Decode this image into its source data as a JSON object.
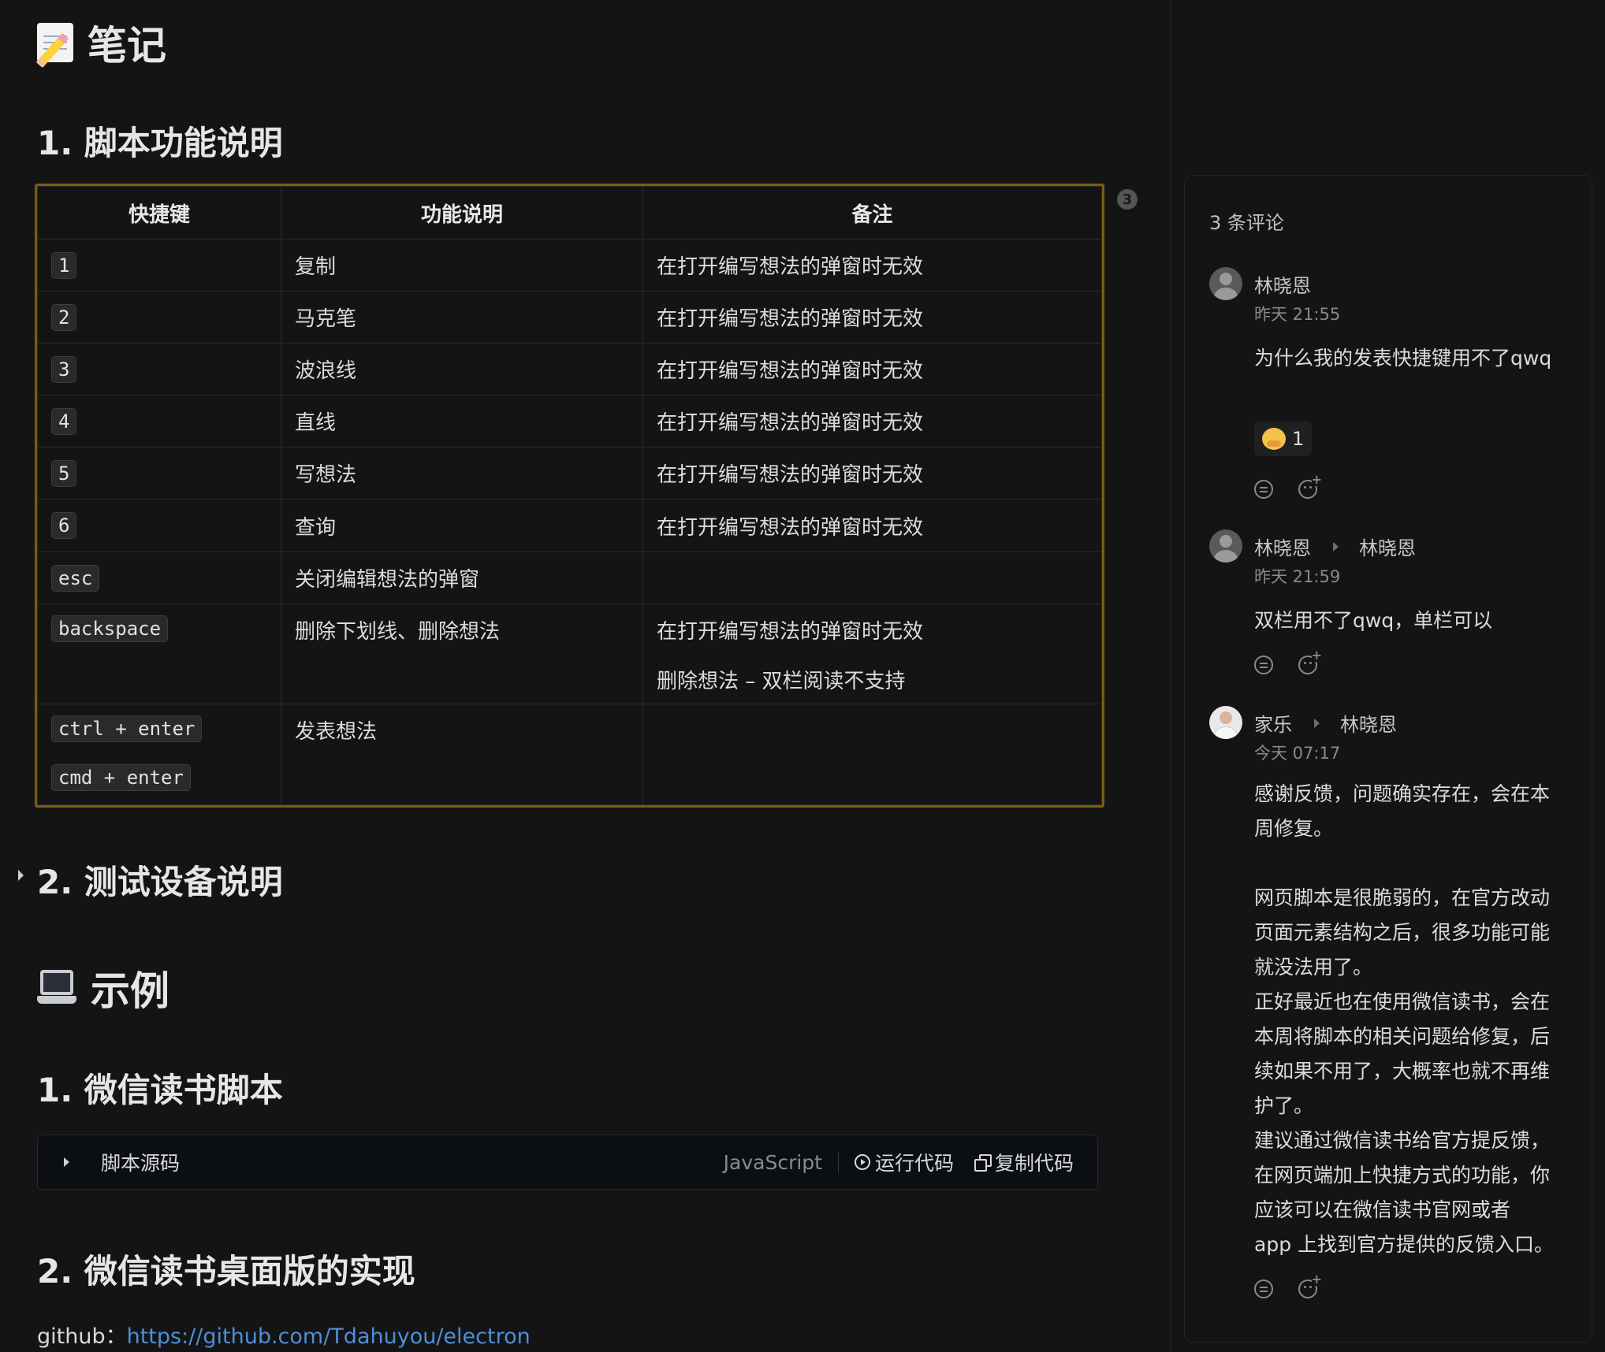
{
  "notes": {
    "title": "笔记",
    "icon": "memo-icon",
    "section1_title": "1. 脚本功能说明",
    "table": {
      "headers": [
        "快捷键",
        "功能说明",
        "备注"
      ],
      "rows": [
        {
          "keys": [
            "1"
          ],
          "desc": "复制",
          "notes": [
            "在打开编写想法的弹窗时无效"
          ]
        },
        {
          "keys": [
            "2"
          ],
          "desc": "马克笔",
          "notes": [
            "在打开编写想法的弹窗时无效"
          ]
        },
        {
          "keys": [
            "3"
          ],
          "desc": "波浪线",
          "notes": [
            "在打开编写想法的弹窗时无效"
          ]
        },
        {
          "keys": [
            "4"
          ],
          "desc": "直线",
          "notes": [
            "在打开编写想法的弹窗时无效"
          ]
        },
        {
          "keys": [
            "5"
          ],
          "desc": "写想法",
          "notes": [
            "在打开编写想法的弹窗时无效"
          ]
        },
        {
          "keys": [
            "6"
          ],
          "desc": "查询",
          "notes": [
            "在打开编写想法的弹窗时无效"
          ]
        },
        {
          "keys": [
            "esc"
          ],
          "desc": "关闭编辑想法的弹窗",
          "notes": []
        },
        {
          "keys": [
            "backspace"
          ],
          "desc": "删除下划线、删除想法",
          "notes": [
            "在打开编写想法的弹窗时无效",
            "删除想法 – 双栏阅读不支持"
          ]
        },
        {
          "keys": [
            "ctrl + enter",
            "cmd + enter"
          ],
          "desc": "发表想法",
          "notes": []
        }
      ]
    },
    "comment_badge": "3",
    "section2_title": "2. 测试设备说明"
  },
  "examples": {
    "title": "示例",
    "icon": "laptop-icon",
    "section1_title": "1. 微信读书脚本",
    "code_block": {
      "title": "脚本源码",
      "language": "JavaScript",
      "run_label": "运行代码",
      "copy_label": "复制代码"
    },
    "section2_title": "2. 微信读书桌面版的实现",
    "github_label": "github：",
    "github_url": "https://github.com/Tdahuyou/electron"
  },
  "comments": {
    "count_label": "3 条评论",
    "items": [
      {
        "author": "林晓恩",
        "reply_to": "",
        "time": "昨天 21:55",
        "body": "为什么我的发表快捷键用不了qwq",
        "reaction_count": "1"
      },
      {
        "author": "林晓恩",
        "reply_to": "林晓恩",
        "time": "昨天 21:59",
        "body": "双栏用不了qwq，单栏可以"
      },
      {
        "author": "家乐",
        "reply_to": "林晓恩",
        "time": "今天 07:17",
        "body": "感谢反馈，问题确实存在，会在本\n周修复。\n\n网页脚本是很脆弱的，在官方改动\n页面元素结构之后，很多功能可能\n就没法用了。\n正好最近也在使用微信读书，会在\n本周将脚本的相关问题给修复，后\n续如果不用了，大概率也就不再维\n护了。\n建议通过微信读书给官方提反馈，\n在网页端加上快捷方式的功能，你\n应该可以在微信读书官网或者\napp 上找到官方提供的反馈入口。"
      }
    ]
  }
}
